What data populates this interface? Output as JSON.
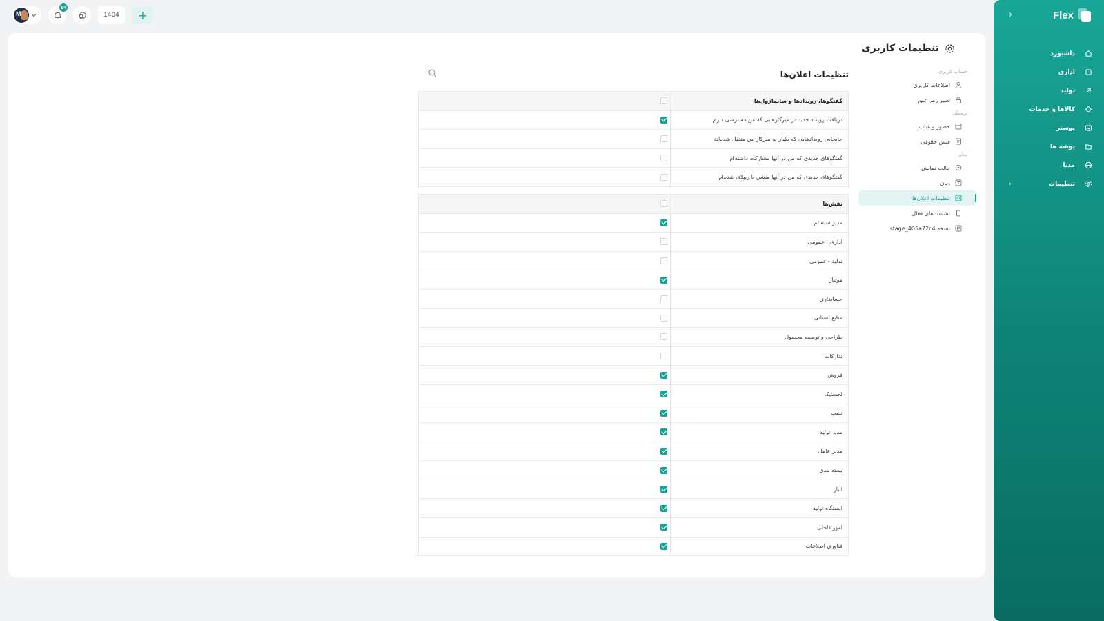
{
  "brand": {
    "name": "Flex"
  },
  "nav": [
    {
      "label": "داشبورد",
      "icon": "home-icon"
    },
    {
      "label": "اداری",
      "icon": "building-icon"
    },
    {
      "label": "تولید",
      "icon": "rocket-icon"
    },
    {
      "label": "کالاها و خدمات",
      "icon": "box-icon"
    },
    {
      "label": "پوستر",
      "icon": "image-icon"
    },
    {
      "label": "پوشه ها",
      "icon": "folder-icon"
    },
    {
      "label": "مدیا",
      "icon": "film-icon"
    },
    {
      "label": "تنظیمات",
      "icon": "gear-icon",
      "has_children": true
    }
  ],
  "topbar": {
    "notifications_count": "14",
    "year": "1404",
    "avatar_initials": "M"
  },
  "page": {
    "title": "تنظیمات کاربری"
  },
  "subnav": {
    "groups": [
      {
        "title": "حساب کاربری",
        "items": [
          {
            "label": "اطلاعات کاربری",
            "icon": "user-icon"
          },
          {
            "label": "تغییر رمز عبور",
            "icon": "lock-icon"
          }
        ]
      },
      {
        "title": "پرسنلی",
        "items": [
          {
            "label": "حضور و غیاب",
            "icon": "calendar-icon"
          },
          {
            "label": "فیش حقوقی",
            "icon": "receipt-icon"
          }
        ]
      },
      {
        "title": "سایر",
        "items": [
          {
            "label": "حالت نمایش",
            "icon": "palette-icon"
          },
          {
            "label": "زبان",
            "icon": "language-icon"
          },
          {
            "label": "تنظیمات اعلان‌ها",
            "icon": "bell-icon",
            "active": true
          },
          {
            "label": "نشست‌های فعال",
            "icon": "device-icon"
          },
          {
            "label": "نسخه stage_405a72c4",
            "icon": "version-icon"
          }
        ]
      }
    ]
  },
  "section": {
    "title": "تنظیمات اعلان‌ها"
  },
  "tables": [
    {
      "header": "گفتگوها، رویدادها و سایماژول‌ها",
      "header_checked": false,
      "rows": [
        {
          "label": "دریافت رویداد جدید در میزکارهایی که من دسترسی دارم",
          "checked": true
        },
        {
          "label": "جابجایی رویدادهایی که یکبار به میزکار من منتقل شده‌اند",
          "checked": false
        },
        {
          "label": "گفتگوهای جدیدی که من در آنها مشارکت داشته‌ام",
          "checked": false
        },
        {
          "label": "گفتگوهای جدیدی که من در آنها منشن یا ریپلای شده‌ام",
          "checked": false
        }
      ]
    },
    {
      "header": "نقش‌ها",
      "header_checked": false,
      "rows": [
        {
          "label": "مدیر سیستم",
          "checked": true
        },
        {
          "label": "اداری - عمومی",
          "checked": false
        },
        {
          "label": "تولید - عمومی",
          "checked": false
        },
        {
          "label": "مونتاژ",
          "checked": true
        },
        {
          "label": "حسابداری",
          "checked": false
        },
        {
          "label": "منابع انسانی",
          "checked": false
        },
        {
          "label": "طراحی و توسعه محصول",
          "checked": false
        },
        {
          "label": "تدارکات",
          "checked": false
        },
        {
          "label": "فروش",
          "checked": true
        },
        {
          "label": "لجستیک",
          "checked": true
        },
        {
          "label": "نصب",
          "checked": true
        },
        {
          "label": "مدیر تولید",
          "checked": true
        },
        {
          "label": "مدیر عامل",
          "checked": true
        },
        {
          "label": "بسته بندی",
          "checked": true
        },
        {
          "label": "انبار",
          "checked": true
        },
        {
          "label": "ایستگاه تولید",
          "checked": true
        },
        {
          "label": "امور داخلی",
          "checked": true
        },
        {
          "label": "فناوری اطلاعات",
          "checked": true
        }
      ]
    }
  ],
  "colors": {
    "accent": "#16a394",
    "sidebar_top": "#18a697",
    "sidebar_bottom": "#0a6c62"
  }
}
